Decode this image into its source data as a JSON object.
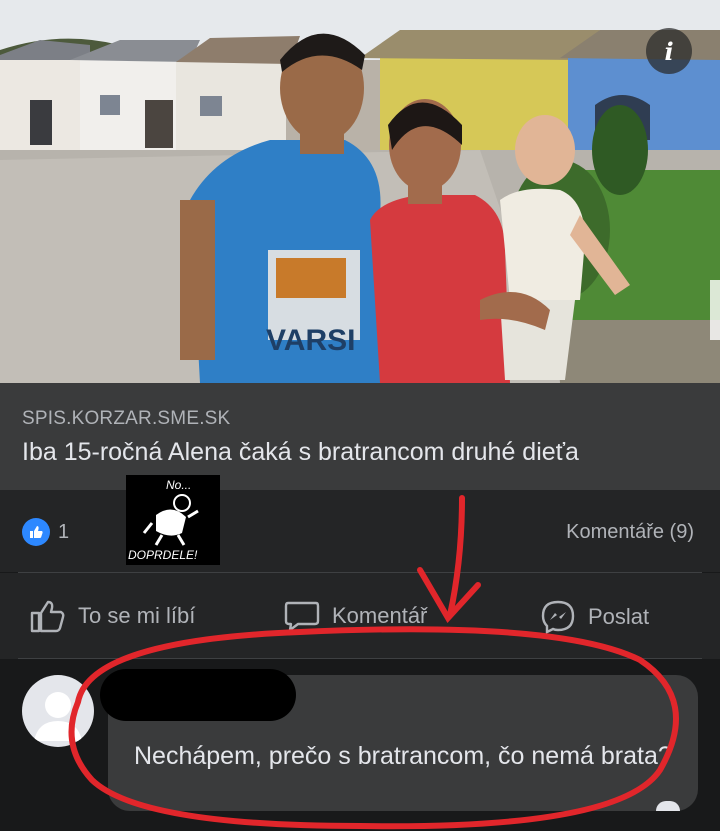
{
  "post": {
    "info_icon": "i",
    "link_domain": "SPIS.KORZAR.SME.SK",
    "link_title": "Iba 15-ročná Alena čaká s bratrancom druhé dieťa",
    "photo": {
      "shirt_text": "VARSI"
    }
  },
  "sticker": {
    "top_text": "No...",
    "bottom_text": "DOPRDELE!"
  },
  "stats": {
    "like_count": "1",
    "comments_label": "Komentáře (9)"
  },
  "actions": {
    "like_label": "To se mi líbí",
    "comment_label": "Komentář",
    "share_label": "Poslat"
  },
  "comment": {
    "text": "Nechápem, prečo s bratrancom, čo nemá brata?"
  },
  "colors": {
    "annotation_red": "#e1262b",
    "link_blue": "#2d88ff"
  },
  "icons": {
    "info": "info-icon",
    "like": "thumbs-up-icon",
    "comment": "comment-icon",
    "share": "messenger-icon"
  }
}
